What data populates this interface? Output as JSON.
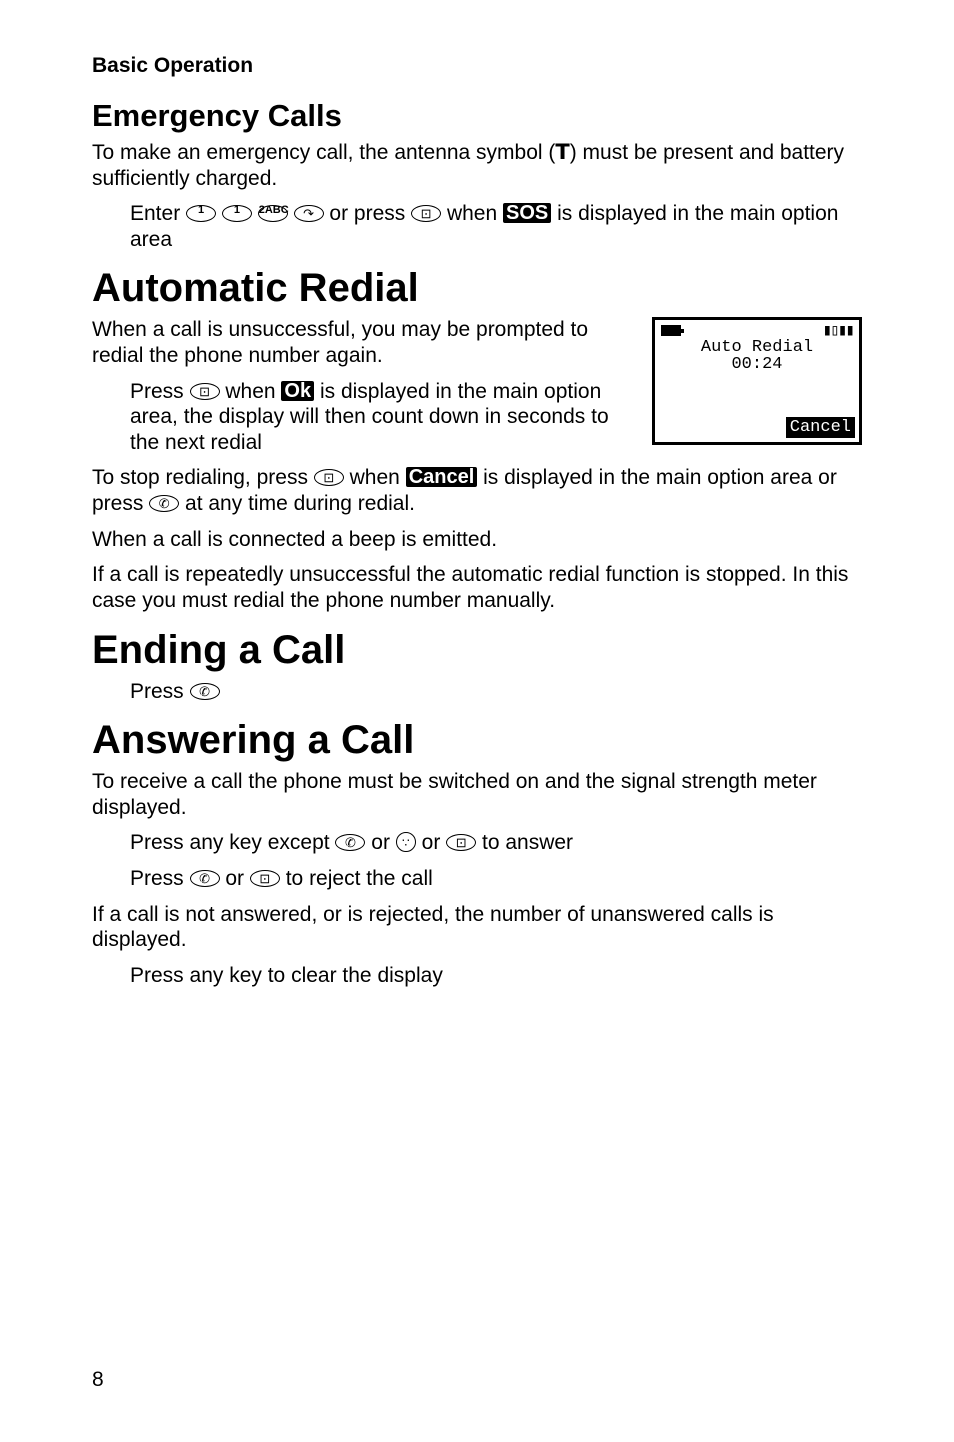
{
  "breadcrumb": "Basic Operation",
  "emergency": {
    "heading": "Emergency Calls",
    "para1_a": "To make an emergency call, the antenna symbol (",
    "antenna": "T",
    "para1_b": ") must be present and battery sufficiently charged.",
    "step_a": "Enter ",
    "step_b": " or press ",
    "step_c": " when ",
    "sos": "SOS",
    "step_d": " is displayed in the main option area"
  },
  "auto_redial": {
    "heading": "Automatic Redial",
    "para1": "When a call is unsuccessful, you may be prompted to redial the phone number again.",
    "step_a": "Press ",
    "step_b": " when ",
    "ok": "Ok",
    "step_c": " is displayed in the main option area, the display will then count down in seconds to the next redial",
    "stop_a": "To stop redialing, press ",
    "stop_b": " when ",
    "cancel": "Cancel",
    "stop_c": " is displayed in the main option area or press ",
    "stop_d": " at any time during redial.",
    "connected": "When a call is connected a beep is emitted.",
    "failed": "If a call is repeatedly unsuccessful the automatic redial function is stopped. In this case you must redial the phone number manually.",
    "screen": {
      "line1": "Auto Redial",
      "line2": "00:24",
      "cancel": "Cancel"
    }
  },
  "ending": {
    "heading": "Ending a Call",
    "step": "Press "
  },
  "answering": {
    "heading": "Answering a Call",
    "para1": "To receive a call the phone must be switched on and the signal strength meter  displayed.",
    "step1_a": "Press any key except ",
    "step1_b": " or ",
    "step1_c": " or ",
    "step1_d": " to answer",
    "step2_a": "Press ",
    "step2_b": " or ",
    "step2_c": "  to reject the call",
    "not_answered": "If a call is not answered, or is rejected, the number of unanswered calls is displayed.",
    "clear": "Press any key to clear the display"
  },
  "icons": {
    "key1": "1",
    "key2": "2ABC",
    "send": "↷",
    "softkey": "⊡",
    "end": "✆",
    "nav": "∵",
    "sig": "▮▯▮▮"
  },
  "page_number": "8"
}
